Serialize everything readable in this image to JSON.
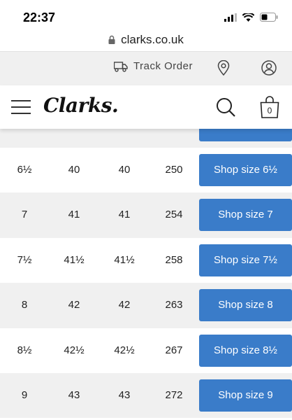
{
  "status_bar": {
    "time": "22:37",
    "icons": [
      "signal-icon",
      "wifi-icon",
      "battery-icon"
    ]
  },
  "browser": {
    "url": "clarks.co.uk",
    "lock_icon": "lock-icon"
  },
  "utility_bar": {
    "track_order_label": "Track Order",
    "icons": [
      "truck-icon",
      "location-pin-icon",
      "account-icon"
    ]
  },
  "header": {
    "logo_text": "Clarks.",
    "bag_count": "0",
    "icons": [
      "menu-icon",
      "search-icon",
      "shopping-bag-icon"
    ]
  },
  "size_rows": [
    {
      "uk": "6½",
      "eu1": "40",
      "eu2": "40",
      "mm": "250",
      "button": "Shop size 6½"
    },
    {
      "uk": "7",
      "eu1": "41",
      "eu2": "41",
      "mm": "254",
      "button": "Shop size 7"
    },
    {
      "uk": "7½",
      "eu1": "41½",
      "eu2": "41½",
      "mm": "258",
      "button": "Shop size 7½"
    },
    {
      "uk": "8",
      "eu1": "42",
      "eu2": "42",
      "mm": "263",
      "button": "Shop size 8"
    },
    {
      "uk": "8½",
      "eu1": "42½",
      "eu2": "42½",
      "mm": "267",
      "button": "Shop size 8½"
    },
    {
      "uk": "9",
      "eu1": "43",
      "eu2": "43",
      "mm": "272",
      "button": "Shop size 9"
    }
  ],
  "colors": {
    "button_blue": "#3a7cc9",
    "row_alt": "#f0f0f0",
    "util_bar": "#f0f0f0"
  }
}
